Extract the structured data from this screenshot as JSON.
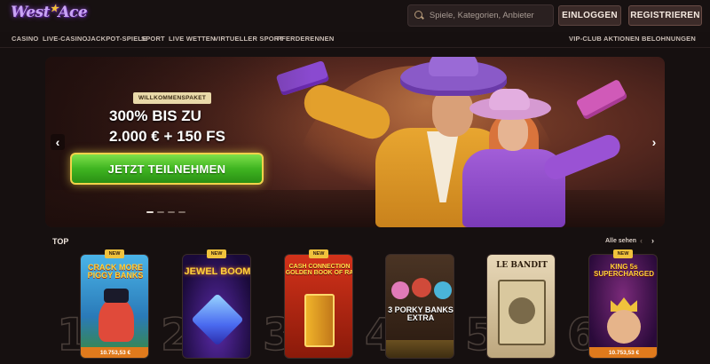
{
  "header": {
    "logo_text": "West",
    "logo_text_2": "Ace",
    "search_placeholder": "Spiele, Kategorien, Anbieter",
    "login_label": "EINLOGGEN",
    "register_label": "REGISTRIEREN"
  },
  "nav": {
    "left": [
      "CASINO",
      "LIVE-CASINO",
      "JACKPOT-SPIELE",
      "SPORT",
      "LIVE WETTEN",
      "VIRTUELLER SPORT",
      "PFERDERENNEN"
    ],
    "right": [
      "VIP-CLUB",
      "AKTIONEN",
      "BELOHNUNGEN"
    ]
  },
  "hero": {
    "badge": "WILLKOMMENSPAKET",
    "line1": "300% BIS ZU",
    "line2": "2.000 € + 150 FS",
    "cta": "JETZT TEILNEHMEN",
    "prev_arrow": "‹",
    "next_arrow": "›",
    "slides": 4,
    "active_slide": 1
  },
  "top": {
    "title": "TOP",
    "see_all": "Alle sehen",
    "prev": "‹",
    "next": "›",
    "games": [
      {
        "rank": "1",
        "new": "NEW",
        "title": "CRACK MORE PIGGY BANKS",
        "jackpot": "10.753,53 €",
        "bg": "#3aa0d8"
      },
      {
        "rank": "2",
        "new": "NEW",
        "title": "JEWEL BOOM",
        "jackpot": "",
        "bg": "#2a1a5a"
      },
      {
        "rank": "3",
        "new": "NEW",
        "title": "CASH CONNECTION GOLDEN BOOK OF RA",
        "jackpot": "",
        "bg": "#c22a14"
      },
      {
        "rank": "4",
        "new": "",
        "title": "3 PORKY BANKS EXTRA",
        "jackpot": "",
        "bg": "#3a2a1a"
      },
      {
        "rank": "5",
        "new": "",
        "title": "LE BANDIT",
        "jackpot": "",
        "bg": "#d6c4a4"
      },
      {
        "rank": "6",
        "new": "NEW",
        "title": "KING 5s SUPERCHARGED",
        "jackpot": "10.753,53 €",
        "bg": "#4a1a5a"
      }
    ]
  }
}
